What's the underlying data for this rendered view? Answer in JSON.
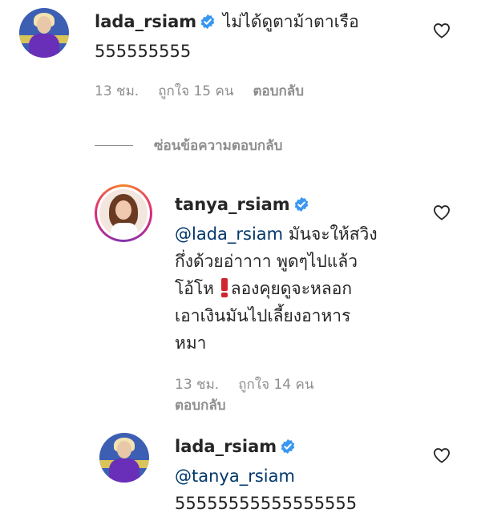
{
  "comments": [
    {
      "username": "lada_rsiam",
      "text_line1": "ไม่ได้ดูตาม้าตาเรือ",
      "text_line2": "555555555",
      "time": "13 ชม.",
      "likes": "ถูกใจ 15 คน",
      "reply_label": "ตอบกลับ"
    },
    {
      "username": "tanya_rsiam",
      "mention": "@lada_rsiam",
      "text_line1": "มันจะให้สวิง",
      "text_line2": "กึ่งด้วยอ่าาาา พูดๆไปแล้ว",
      "text_line3_a": "โอ้โห",
      "text_line3_b": "ลองคุยดูจะหลอก",
      "text_line4": "เอาเงินมันไปเลี้ยงอาหาร",
      "text_line5": "หมา",
      "time": "13 ชม.",
      "likes": "ถูกใจ 14 คน",
      "reply_label": "ตอบกลับ"
    },
    {
      "username": "lada_rsiam",
      "mention": "@tanya_rsiam",
      "text_line1": "55555555555555555"
    }
  ],
  "hide_replies_label": "ซ่อนข้อความตอบกลับ",
  "icons": {
    "verified": "verified-badge-icon",
    "heart": "heart-outline-icon",
    "emoji": "red-exclamation-icon"
  },
  "colors": {
    "text": "#262626",
    "muted": "#8e8e8e",
    "mention": "#00376b",
    "verified": "#3897f0"
  }
}
